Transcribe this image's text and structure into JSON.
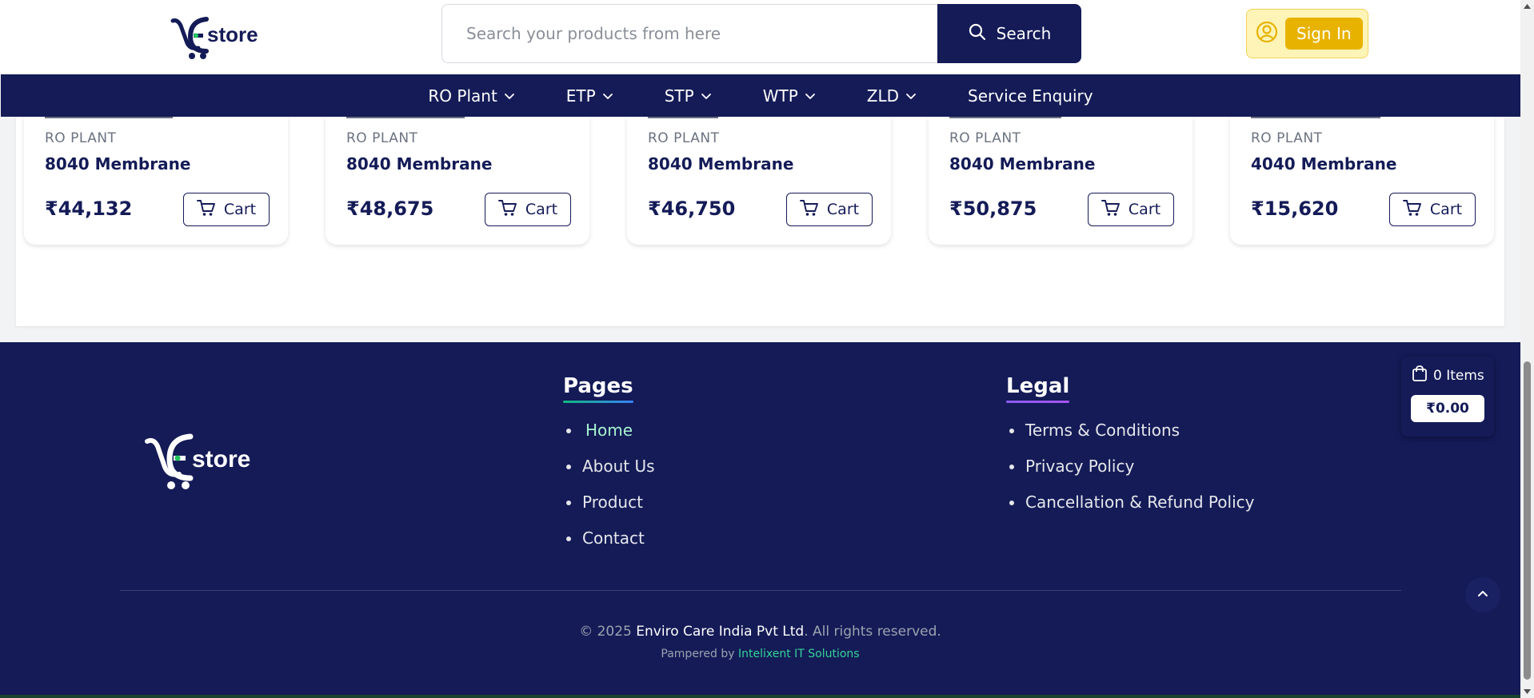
{
  "brand": {
    "logo_text": "store",
    "logo_letter": "E"
  },
  "search": {
    "placeholder": "Search your products from here",
    "button_label": "Search"
  },
  "auth": {
    "signin_label": "Sign In"
  },
  "nav": [
    {
      "label": "RO Plant",
      "dropdown": true
    },
    {
      "label": "ETP",
      "dropdown": true
    },
    {
      "label": "STP",
      "dropdown": true
    },
    {
      "label": "WTP",
      "dropdown": true
    },
    {
      "label": "ZLD",
      "dropdown": true
    },
    {
      "label": "Service Enquiry",
      "dropdown": false
    }
  ],
  "products": [
    {
      "category": "RO PLANT",
      "name": "8040 Membrane",
      "price": "₹44,132",
      "cart_label": "Cart"
    },
    {
      "category": "RO PLANT",
      "name": "8040 Membrane",
      "price": "₹48,675",
      "cart_label": "Cart"
    },
    {
      "category": "RO PLANT",
      "name": "8040 Membrane",
      "price": "₹46,750",
      "cart_label": "Cart"
    },
    {
      "category": "RO PLANT",
      "name": "8040 Membrane",
      "price": "₹50,875",
      "cart_label": "Cart"
    },
    {
      "category": "RO PLANT",
      "name": "4040 Membrane",
      "price": "₹15,620",
      "cart_label": "Cart"
    }
  ],
  "footer": {
    "pages": {
      "title": "Pages",
      "links": [
        "Home",
        "About Us",
        "Product",
        "Contact"
      ],
      "active": "Home"
    },
    "legal": {
      "title": "Legal",
      "links": [
        "Terms & Conditions",
        "Privacy Policy",
        "Cancellation & Refund Policy"
      ]
    },
    "copyright_prefix": "© 2025",
    "company": "Enviro Care India Pvt Ltd",
    "copyright_suffix": ". All rights reserved.",
    "powered_prefix": "Pampered by",
    "vendor": "Intelixent IT Solutions"
  },
  "mini_cart": {
    "items_label": "0 Items",
    "total": "₹0.00"
  },
  "colors": {
    "navy": "#141b57",
    "accent_yellow": "#e8b300",
    "green": "#34d399"
  },
  "icons": [
    "search-icon",
    "user-circle-icon",
    "chevron-down-icon",
    "cart-icon",
    "bag-icon",
    "chevron-up-icon"
  ]
}
